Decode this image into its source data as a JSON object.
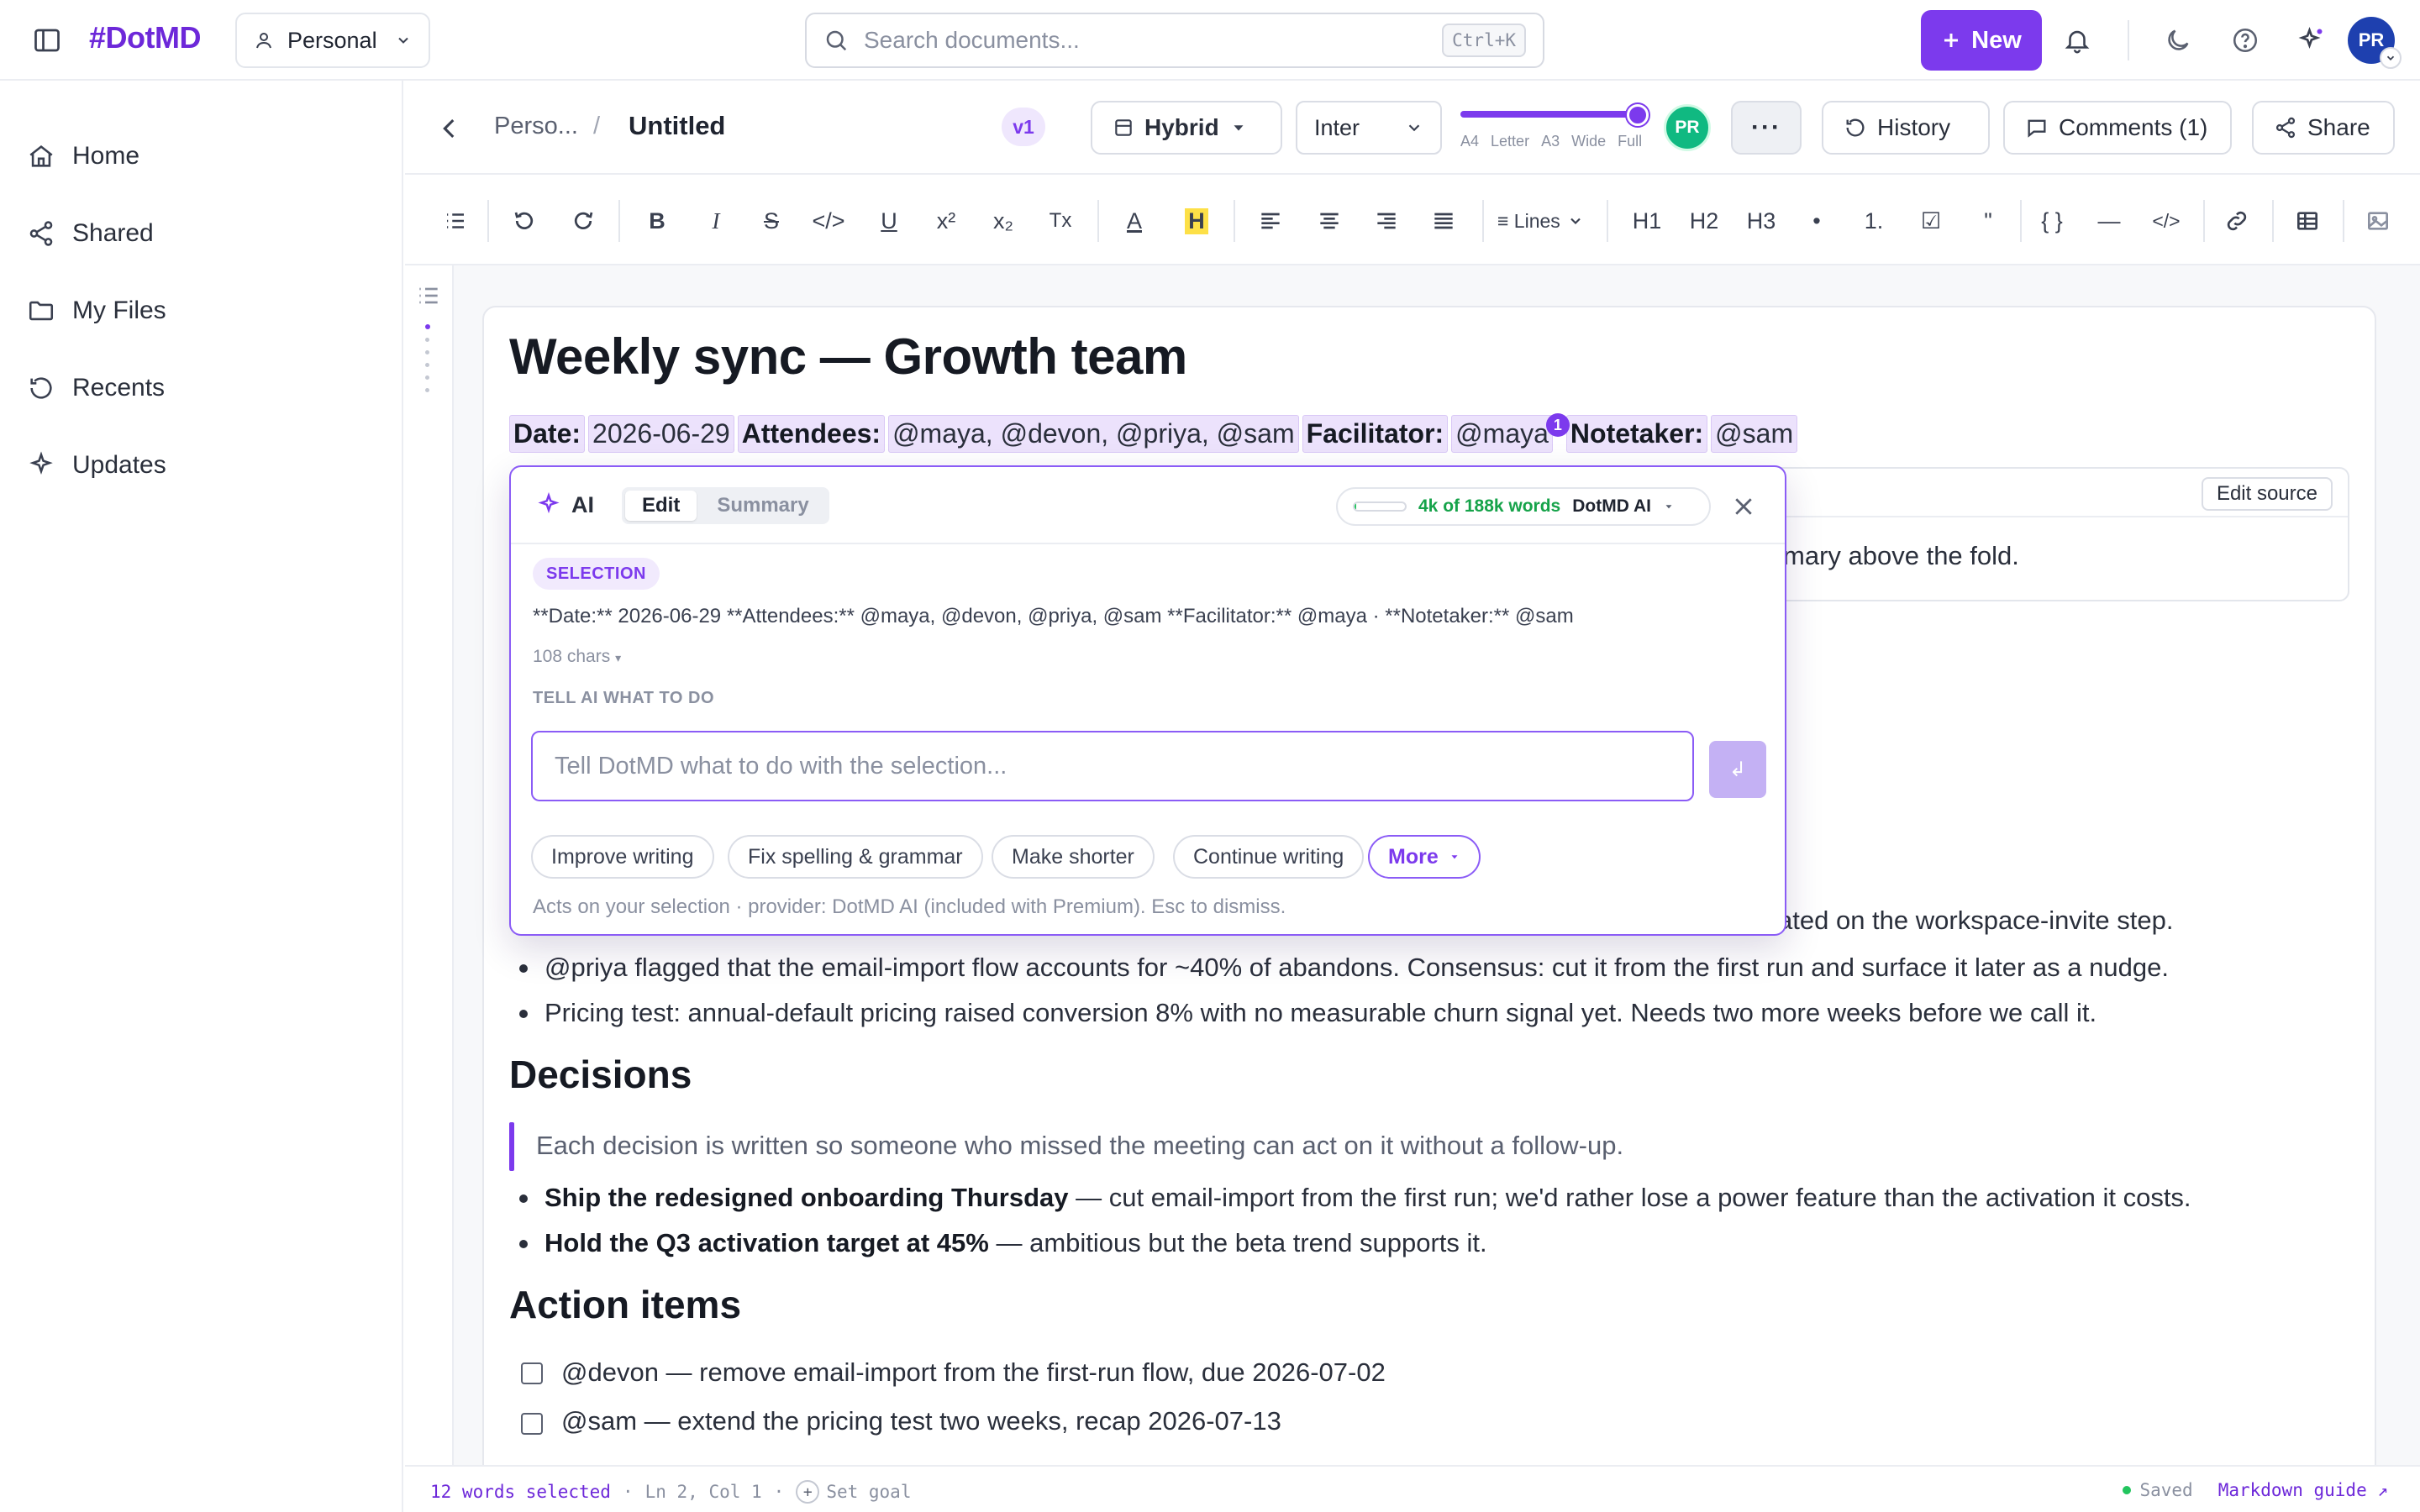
{
  "app": {
    "logo_hash": "#",
    "logo_name": "DotMD",
    "workspace": "Personal",
    "search_placeholder": "Search documents...",
    "search_shortcut": "Ctrl+K",
    "new_label": "New",
    "user_initials": "PR"
  },
  "sidebar": {
    "items": [
      {
        "label": "Home",
        "icon": "home-icon"
      },
      {
        "label": "Shared",
        "icon": "share-icon"
      },
      {
        "label": "My Files",
        "icon": "folder-icon"
      },
      {
        "label": "Recents",
        "icon": "history-icon"
      },
      {
        "label": "Updates",
        "icon": "sparkle-icon"
      }
    ]
  },
  "docbar": {
    "breadcrumb_parent": "Perso...",
    "breadcrumb_sep": "/",
    "title": "Untitled",
    "version": "v1",
    "view_mode": "Hybrid",
    "font": "Inter",
    "width_options": [
      "A4",
      "Letter",
      "A3",
      "Wide",
      "Full"
    ],
    "width_selected": "Full",
    "collaborator_initials": "PR",
    "more_label": "···",
    "history_label": "History",
    "comments_label": "Comments (1)",
    "share_label": "Share"
  },
  "toolbar": {
    "bold": "B",
    "italic": "I",
    "strike": "S",
    "code": "</>",
    "underline": "U",
    "superscript": "x²",
    "subscript": "x₂",
    "clear": "Tx",
    "text_color": "A",
    "highlight": "H",
    "line_spacing": "≡ Lines",
    "h1": "H1",
    "h2": "H2",
    "h3": "H3",
    "bullet": "•",
    "ordered": "1.",
    "task": "☑",
    "quote": "\"",
    "code_block": "{ }",
    "hr": "—",
    "embed": "</>"
  },
  "doc": {
    "title": "Weekly sync — Growth team",
    "meta": {
      "date_label": "Date:",
      "date_value": "2026-06-29",
      "attendees_label": "Attendees:",
      "attendees_value": "@maya, @devon, @priya, @sam",
      "facilitator_label": "Facilitator:",
      "facilitator_value": "@maya",
      "comment_count": "1",
      "notetaker_label": "Notetaker:",
      "notetaker_value": "@sam"
    },
    "callout_edit_source": "Edit source",
    "callout_text": "mary above the fold.",
    "discussion_partial": "ated on the workspace-invite step.",
    "discussion": [
      "@priya flagged that the email-import flow accounts for ~40% of abandons. Consensus: cut it from the first run and surface it later as a nudge.",
      "Pricing test: annual-default pricing raised conversion 8% with no measurable churn signal yet. Needs two more weeks before we call it."
    ],
    "decisions_heading": "Decisions",
    "decisions_quote": "Each decision is written so someone who missed the meeting can act on it without a follow-up.",
    "decisions": [
      {
        "bold": "Ship the redesigned onboarding Thursday",
        "rest": " — cut email-import from the first run; we'd rather lose a power feature than the activation it costs."
      },
      {
        "bold": "Hold the Q3 activation target at 45%",
        "rest": " — ambitious but the beta trend supports it."
      }
    ],
    "actions_heading": "Action items",
    "actions": [
      "@devon — remove email-import from the first-run flow, due 2026-07-02",
      "@sam — extend the pricing test two weeks, recap 2026-07-13"
    ]
  },
  "ai": {
    "label": "AI",
    "tab_edit": "Edit",
    "tab_summary": "Summary",
    "usage_words": "4k of 188k words",
    "usage_fraction": 0.02,
    "provider": "DotMD AI",
    "selection_label": "SELECTION",
    "selection_text": "**Date:** 2026-06-29 **Attendees:** @maya, @devon, @priya, @sam **Facilitator:** @maya · **Notetaker:** @sam",
    "selection_count": "108 chars",
    "instruction_label": "TELL AI WHAT TO DO",
    "input_placeholder": "Tell DotMD what to do with the selection...",
    "submit_label": "↲",
    "chips": [
      "Improve writing",
      "Fix spelling & grammar",
      "Make shorter",
      "Continue writing"
    ],
    "more_label": "More",
    "footer": "Acts on your selection · provider: DotMD AI (included with Premium). Esc to dismiss."
  },
  "status": {
    "selected": "12 words selected",
    "sep": "·",
    "position": "Ln 2, Col 1",
    "goal": "Set goal",
    "saved": "Saved",
    "guide": "Markdown guide ↗"
  },
  "colors": {
    "accent": "#7c3aed",
    "accent_soft": "#ece2fc",
    "success": "#22c55e",
    "avatar_user": "#1e40af",
    "avatar_collab": "#10b981"
  }
}
